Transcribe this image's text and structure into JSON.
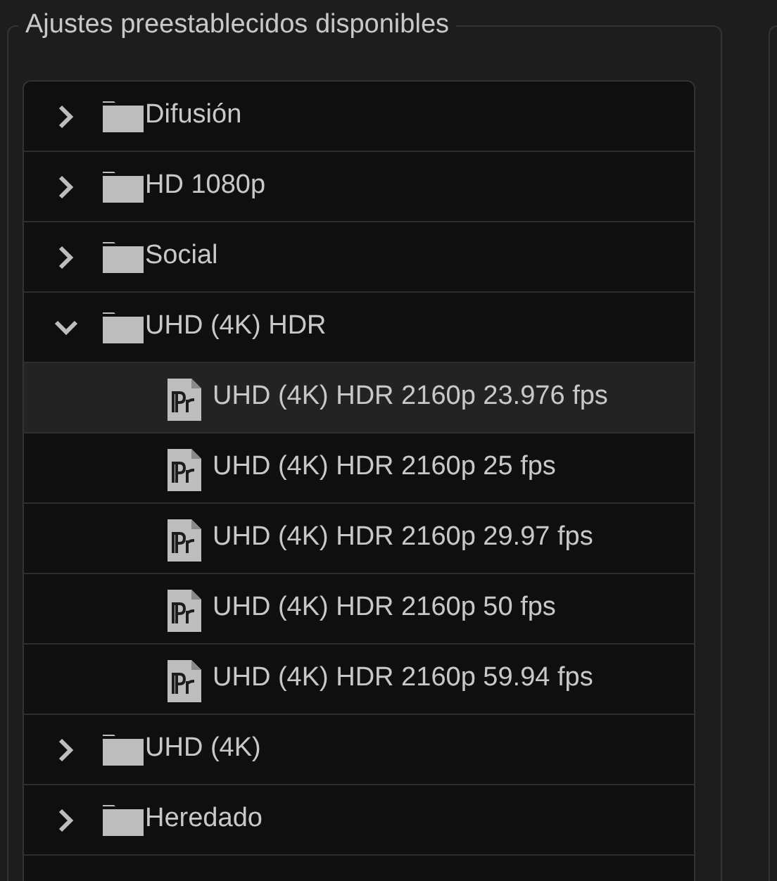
{
  "panel": {
    "title": "Ajustes preestablecidos disponibles"
  },
  "presets": [
    {
      "label": "Difusión",
      "kind": "folder",
      "expanded": false,
      "selected": false
    },
    {
      "label": "HD 1080p",
      "kind": "folder",
      "expanded": false,
      "selected": false
    },
    {
      "label": "Social",
      "kind": "folder",
      "expanded": false,
      "selected": false
    },
    {
      "label": "UHD (4K) HDR",
      "kind": "folder",
      "expanded": true,
      "selected": false,
      "children": [
        {
          "label": "UHD (4K) HDR 2160p 23.976 fps",
          "kind": "preset",
          "selected": true
        },
        {
          "label": "UHD (4K) HDR 2160p 25 fps",
          "kind": "preset",
          "selected": false
        },
        {
          "label": "UHD (4K) HDR 2160p 29.97 fps",
          "kind": "preset",
          "selected": false
        },
        {
          "label": "UHD (4K) HDR 2160p 50 fps",
          "kind": "preset",
          "selected": false
        },
        {
          "label": "UHD (4K) HDR 2160p 59.94 fps",
          "kind": "preset",
          "selected": false
        }
      ]
    },
    {
      "label": "UHD (4K)",
      "kind": "folder",
      "expanded": false,
      "selected": false
    },
    {
      "label": "Heredado",
      "kind": "folder",
      "expanded": false,
      "selected": false
    }
  ]
}
